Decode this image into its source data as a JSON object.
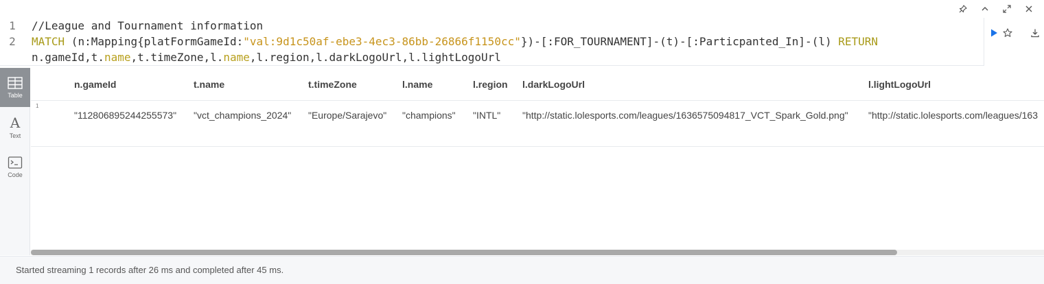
{
  "editor": {
    "line_numbers": [
      "1",
      "2"
    ],
    "comment": "//League and Tournament information",
    "query": {
      "match_kw": "MATCH",
      "node_open": " (n:Mapping{platFormGameId:",
      "game_id_value": "\"val:9d1c50af-ebe3-4ec3-86bb-26866f1150cc\"",
      "rel1": "})-[:FOR_TOURNAMENT]-(t)-[:Particpanted_In]-(l) ",
      "return_kw": "RETURN",
      "ret_a": "n.gameId,t.",
      "ret_name1": "name",
      "ret_b": ",t.timeZone,l.",
      "ret_name2": "name",
      "ret_c": ",l.region,l.darkLogoUrl,l.lightLogoUrl"
    },
    "accent_color": "#1a73e8"
  },
  "controls": {
    "pin_icon": "pin-icon",
    "collapse_icon": "chevron-up-icon",
    "expand_icon": "expand-icon",
    "close_icon": "close-icon"
  },
  "sidebar": {
    "items": [
      {
        "label": "Table",
        "icon": "table-icon",
        "active": true
      },
      {
        "label": "Text",
        "icon": "text-icon",
        "active": false
      },
      {
        "label": "Code",
        "icon": "code-icon",
        "active": false
      }
    ]
  },
  "table": {
    "columns": [
      "n.gameId",
      "t.name",
      "t.timeZone",
      "l.name",
      "l.region",
      "l.darkLogoUrl",
      "l.lightLogoUrl"
    ],
    "rows": [
      {
        "num": "1",
        "cells": [
          "\"112806895244255573\"",
          "\"vct_champions_2024\"",
          "\"Europe/Sarajevo\"",
          "\"champions\"",
          "\"INTL\"",
          "\"http://static.lolesports.com/leagues/1636575094817_VCT_Spark_Gold.png\"",
          "\"http://static.lolesports.com/leagues/163"
        ]
      }
    ]
  },
  "status": {
    "message": "Started streaming 1 records after 26 ms and completed after 45 ms."
  }
}
